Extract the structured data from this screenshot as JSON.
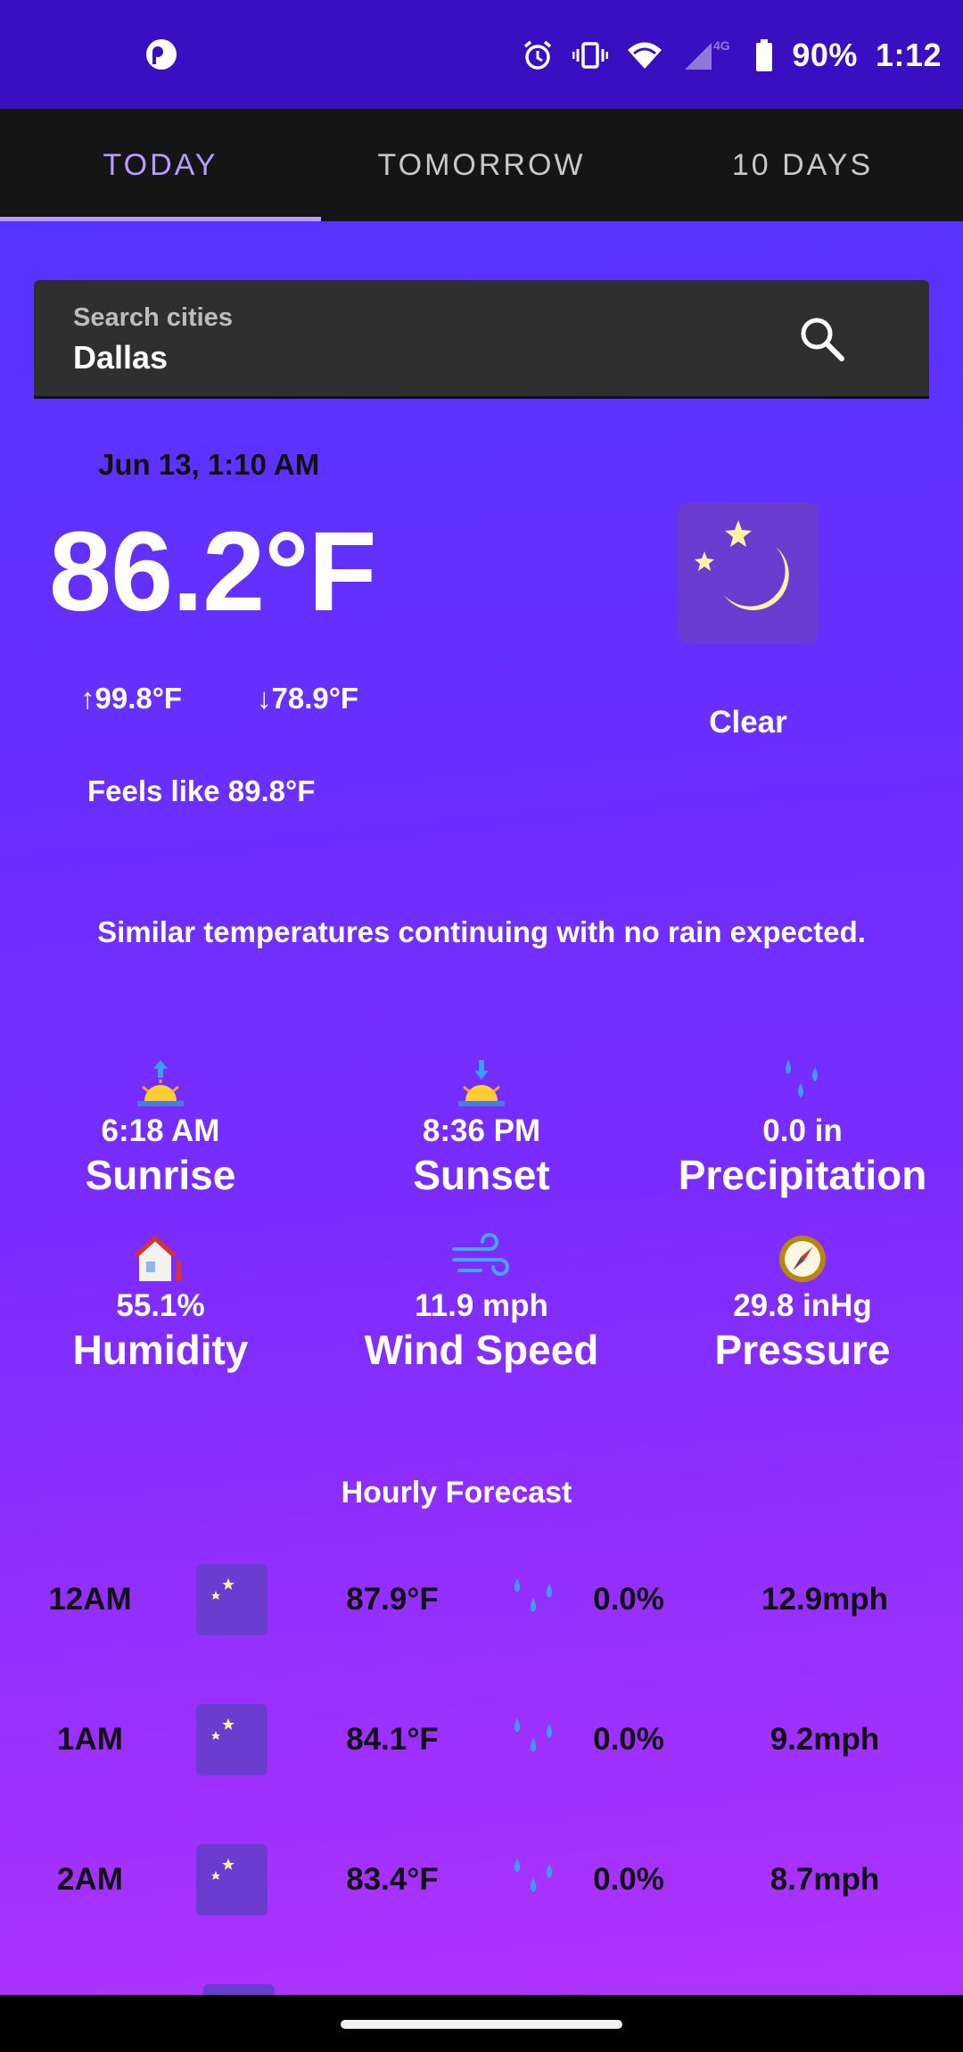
{
  "status_bar": {
    "battery": "90%",
    "time": "1:12",
    "icons": [
      "app-notification-icon",
      "alarm-icon",
      "vibrate-icon",
      "wifi-icon",
      "signal-icon",
      "battery-icon"
    ]
  },
  "tabs": [
    {
      "label": "TODAY",
      "active": true
    },
    {
      "label": "TOMORROW",
      "active": false
    },
    {
      "label": "10 DAYS",
      "active": false
    }
  ],
  "search": {
    "label": "Search cities",
    "value": "Dallas"
  },
  "current": {
    "date": "Jun 13, 1:10 AM",
    "temperature": "86.2°F",
    "high": "↑99.8°F",
    "low": "↓78.9°F",
    "feels_like": "Feels like 89.8°F",
    "condition": "Clear",
    "condition_icon": "moon-stars-icon"
  },
  "summary": "Similar temperatures continuing with no rain expected.",
  "details": [
    {
      "value": "6:18 AM",
      "label": "Sunrise",
      "icon": "sunrise-icon"
    },
    {
      "value": "8:36 PM",
      "label": "Sunset",
      "icon": "sunset-icon"
    },
    {
      "value": "0.0 in",
      "label": "Precipitation",
      "icon": "raindrops-icon"
    },
    {
      "value": "55.1%",
      "label": "Humidity",
      "icon": "humidity-house-icon"
    },
    {
      "value": "11.9 mph",
      "label": "Wind Speed",
      "icon": "wind-icon"
    },
    {
      "value": "29.8 inHg",
      "label": "Pressure",
      "icon": "compass-icon"
    }
  ],
  "hourly": {
    "title": "Hourly Forecast",
    "rows": [
      {
        "time": "12AM",
        "temp": "87.9°F",
        "precip": "0.0%",
        "wind": "12.9mph",
        "icon": "moon-stars-icon"
      },
      {
        "time": "1AM",
        "temp": "84.1°F",
        "precip": "0.0%",
        "wind": "9.2mph",
        "icon": "moon-stars-icon"
      },
      {
        "time": "2AM",
        "temp": "83.4°F",
        "precip": "0.0%",
        "wind": "8.7mph",
        "icon": "moon-stars-icon"
      }
    ]
  },
  "colors": {
    "status_bar": "#3a0fc2",
    "tab_bar": "#151515",
    "tab_active": "#b99cff",
    "gradient_top": "#5533ff",
    "gradient_bottom": "#b033ff",
    "icon_tile": "#6a3ccf"
  }
}
